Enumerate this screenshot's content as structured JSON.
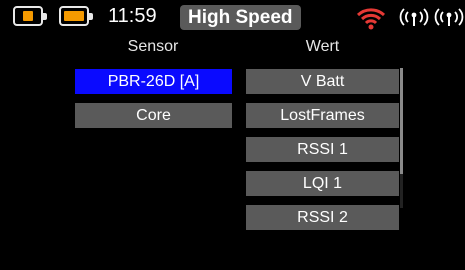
{
  "status": {
    "time": "11:59",
    "mode": "High Speed",
    "battery_color": "#f59a00",
    "wifi_color": "#e53935",
    "icons": [
      "battery-transmitter-icon",
      "battery-receiver-icon",
      "wifi-signal-icon",
      "antenna-signal-icon",
      "antenna-signal-icon"
    ]
  },
  "headers": {
    "sensor": "Sensor",
    "wert": "Wert"
  },
  "sensors": [
    {
      "label": "PBR-26D [A]",
      "selected": true
    },
    {
      "label": "Core",
      "selected": false
    }
  ],
  "werte": [
    "V Batt",
    "LostFrames",
    "RSSI 1",
    "LQI 1",
    "RSSI 2"
  ],
  "colors": {
    "selected": "#0a0aff",
    "cell": "#5a5a5a"
  }
}
